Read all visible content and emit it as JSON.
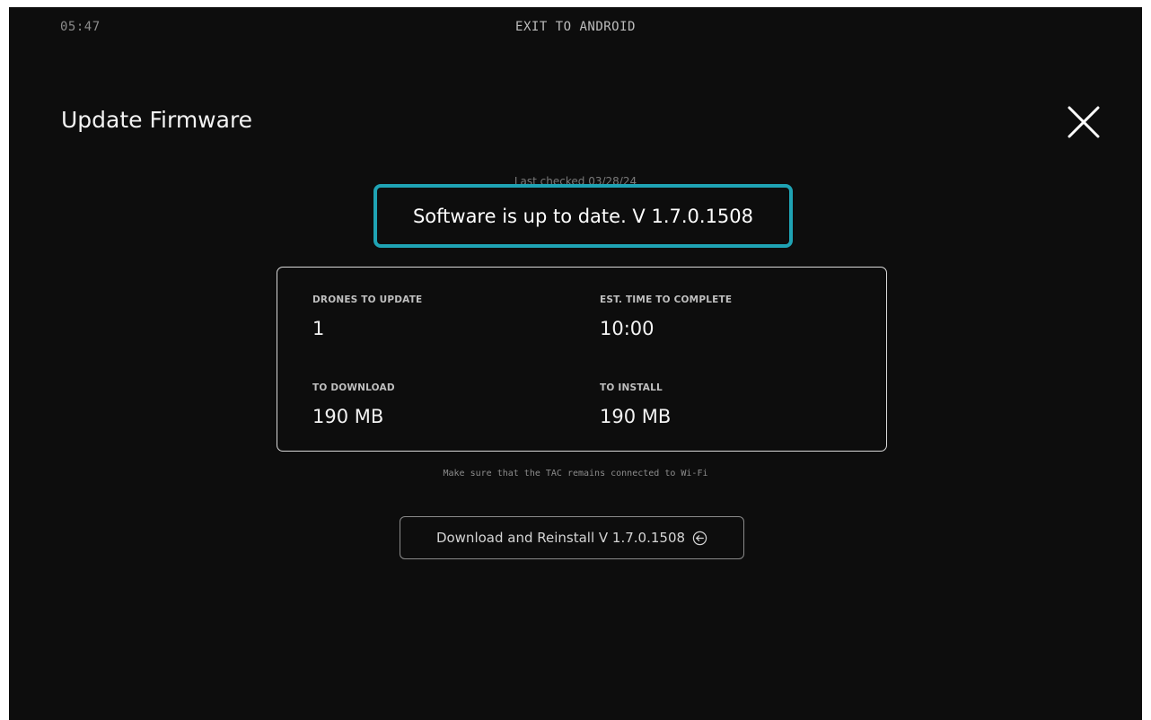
{
  "status_bar": {
    "time": "05:47",
    "exit_label": "EXIT TO ANDROID"
  },
  "header": {
    "title": "Update Firmware",
    "close_icon": "close-icon"
  },
  "update_status": {
    "last_checked": "Last checked 03/28/24",
    "message": "Software is up to date. V 1.7.0.1508",
    "highlight_color": "#1fa3b4"
  },
  "info": {
    "drones_label": "DRONES TO UPDATE",
    "drones_value": "1",
    "time_label": "EST. TIME TO COMPLETE",
    "time_value": "10:00",
    "download_label": "TO DOWNLOAD",
    "download_value": "190 MB",
    "install_label": "TO INSTALL",
    "install_value": "190 MB"
  },
  "note": "Make sure that the TAC remains connected to Wi-Fi",
  "action": {
    "label": "Download and Reinstall V 1.7.0.1508",
    "icon": "circle-arrow-left-icon"
  }
}
